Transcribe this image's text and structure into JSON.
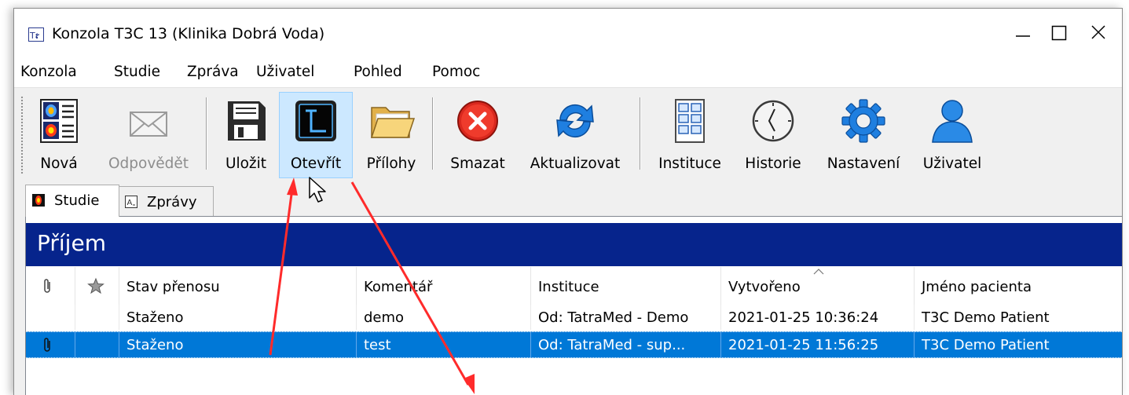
{
  "window": {
    "title": "Konzola T3C 13 (Klinika Dobrá Voda)",
    "icon": "app-logo-icon",
    "controls": [
      "minimize-icon",
      "maximize-icon",
      "close-icon"
    ]
  },
  "menu": {
    "items": [
      {
        "label": "Konzola"
      },
      {
        "label": "Studie"
      },
      {
        "label": "Zpráva"
      },
      {
        "label": "Uživatel"
      },
      {
        "label": "Pohled"
      },
      {
        "label": "Pomoc"
      }
    ]
  },
  "toolbar": {
    "nova": "Nová",
    "odpovedet": "Odpovědět",
    "ulozit": "Uložit",
    "otevrit": "Otevřít",
    "prilohy": "Přílohy",
    "smazat": "Smazat",
    "aktualizovat": "Aktualizovat",
    "instituce": "Instituce",
    "historie": "Historie",
    "nastaveni": "Nastavení",
    "uzivatel": "Uživatel"
  },
  "tabs": {
    "studie": "Studie",
    "zpravy": "Zprávy"
  },
  "panel": {
    "title": "Příjem",
    "columns": {
      "attachment_icon": "paperclip-icon",
      "star_icon": "star-icon",
      "stav": "Stav přenosu",
      "komentar": "Komentář",
      "instituce": "Instituce",
      "vytvoreno": "Vytvořeno",
      "jmeno": "Jméno pacienta"
    },
    "rows": [
      {
        "stav": "Staženo",
        "komentar": "demo",
        "instituce": "Od: TatraMed - Demo",
        "vytvoreno": "2021-01-25 10:36:24",
        "jmeno": "T3C Demo Patient"
      },
      {
        "stav": "Staženo",
        "komentar": "test",
        "instituce": "Od: TatraMed - sup...",
        "vytvoreno": "2021-01-25 11:56:25",
        "jmeno": "T3C Demo Patient"
      }
    ]
  },
  "colors": {
    "banner": "#06248c",
    "selection": "#0078d7",
    "hover": "#cce8ff",
    "arrow": "#ff2b2b"
  }
}
